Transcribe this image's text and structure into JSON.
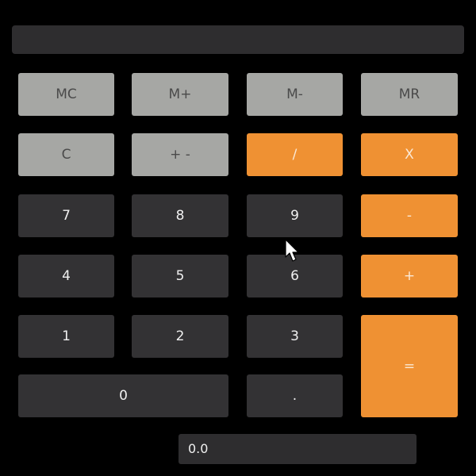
{
  "display": {
    "value": ""
  },
  "memory": {
    "mc": "MC",
    "m_plus": "M+",
    "m_minus": "M-",
    "mr": "MR"
  },
  "functions": {
    "clear": "C",
    "negate": "+ -",
    "divide": "/",
    "multiply": "X",
    "subtract": "-",
    "add": "+",
    "equals": "="
  },
  "digits": {
    "d7": "7",
    "d8": "8",
    "d9": "9",
    "d4": "4",
    "d5": "5",
    "d6": "6",
    "d1": "1",
    "d2": "2",
    "d3": "3",
    "d0": "0",
    "dot": "."
  },
  "status": {
    "value": "0.0"
  },
  "colors": {
    "memory_button": "#a6a7a4",
    "number_button": "#333234",
    "operator_button": "#ef9133",
    "background": "#000000"
  },
  "icons": {
    "cursor": "mouse-pointer-icon"
  }
}
